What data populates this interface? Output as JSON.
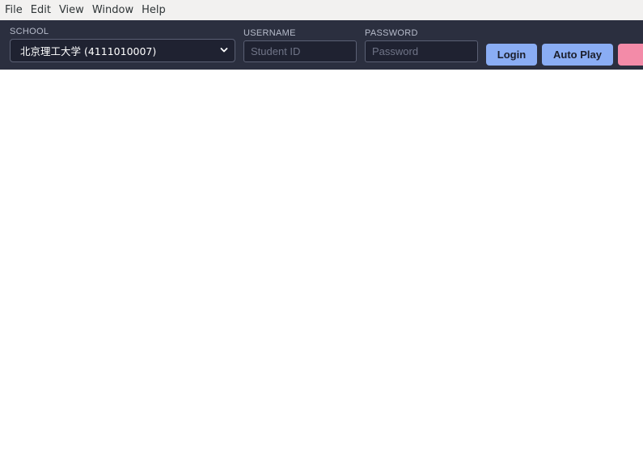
{
  "menubar": {
    "items": [
      {
        "label": "File"
      },
      {
        "label": "Edit"
      },
      {
        "label": "View"
      },
      {
        "label": "Window"
      },
      {
        "label": "Help"
      }
    ]
  },
  "login": {
    "school_label": "SCHOOL",
    "school_value": "北京理工大学 (4111010007)",
    "username_label": "USERNAME",
    "username_placeholder": "Student ID",
    "username_value": "",
    "password_label": "PASSWORD",
    "password_placeholder": "Password",
    "password_value": "",
    "login_button": "Login",
    "autoplay_button": "Auto Play"
  },
  "colors": {
    "toolbar_bg": "#2b2f3f",
    "accent_blue": "#8aadf4",
    "accent_pink": "#f38ba8",
    "menubar_bg": "#f2f1f0"
  }
}
